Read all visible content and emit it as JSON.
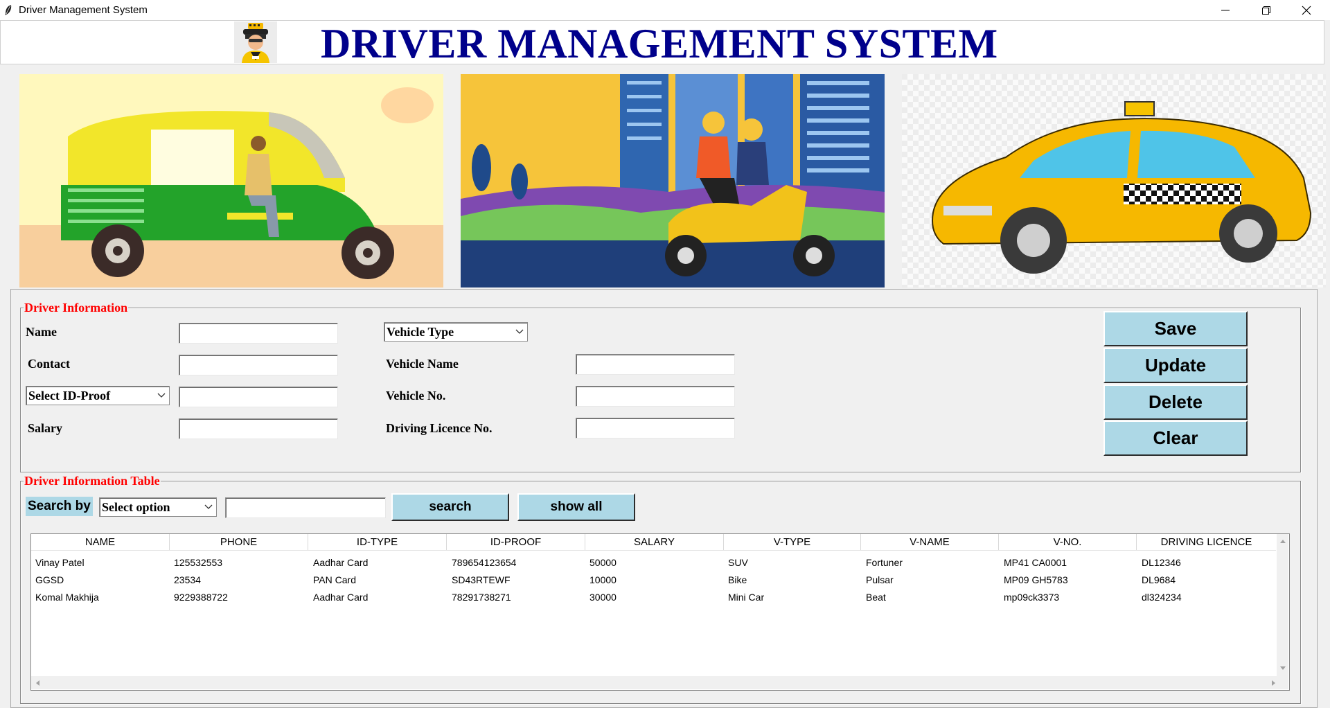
{
  "window": {
    "title": "Driver Management System"
  },
  "header": {
    "title": "DRIVER MANAGEMENT SYSTEM"
  },
  "driver_info": {
    "legend": "Driver Information",
    "name_label": "Name",
    "contact_label": "Contact",
    "id_proof_select": "Select ID-Proof",
    "salary_label": "Salary",
    "vehicle_type_select": "Vehicle Type",
    "vehicle_name_label": "Vehicle Name",
    "vehicle_no_label": "Vehicle No.",
    "licence_label": "Driving Licence No.",
    "values": {
      "name": "",
      "contact": "",
      "id_proof": "",
      "salary": "",
      "vehicle_name": "",
      "vehicle_no": "",
      "licence": ""
    }
  },
  "actions": {
    "save": "Save",
    "update": "Update",
    "delete": "Delete",
    "clear": "Clear"
  },
  "table_section": {
    "legend": "Driver Information Table",
    "search_by_label": "Search by",
    "search_select": "Select option",
    "search_value": "",
    "search_button": "search",
    "show_all_button": "show all",
    "columns": [
      "NAME",
      "PHONE",
      "ID-TYPE",
      "ID-PROOF",
      "SALARY",
      "V-TYPE",
      "V-NAME",
      "V-NO.",
      "DRIVING LICENCE"
    ],
    "rows": [
      [
        "Vinay Patel",
        "125532553",
        "Aadhar Card",
        "789654123654",
        "50000",
        "SUV",
        "Fortuner",
        "MP41 CA0001",
        "DL12346"
      ],
      [
        "GGSD",
        "23534",
        "PAN Card",
        "SD43RTEWF",
        "10000",
        "Bike",
        "Pulsar",
        "MP09 GH5783",
        "DL9684"
      ],
      [
        "Komal Makhija",
        "9229388722",
        "Aadhar Card",
        "78291738271",
        "30000",
        "Mini Car",
        "Beat",
        "mp09ck3373",
        "dl324234"
      ]
    ]
  },
  "icons": {
    "app": "feather-icon",
    "logo": "taxi-driver-icon",
    "images": [
      "auto-rickshaw-illustration",
      "scooter-riders-illustration",
      "taxi-car-illustration"
    ]
  },
  "colors": {
    "heading": "#00008b",
    "legend": "#ff0000",
    "button": "#add8e6"
  }
}
